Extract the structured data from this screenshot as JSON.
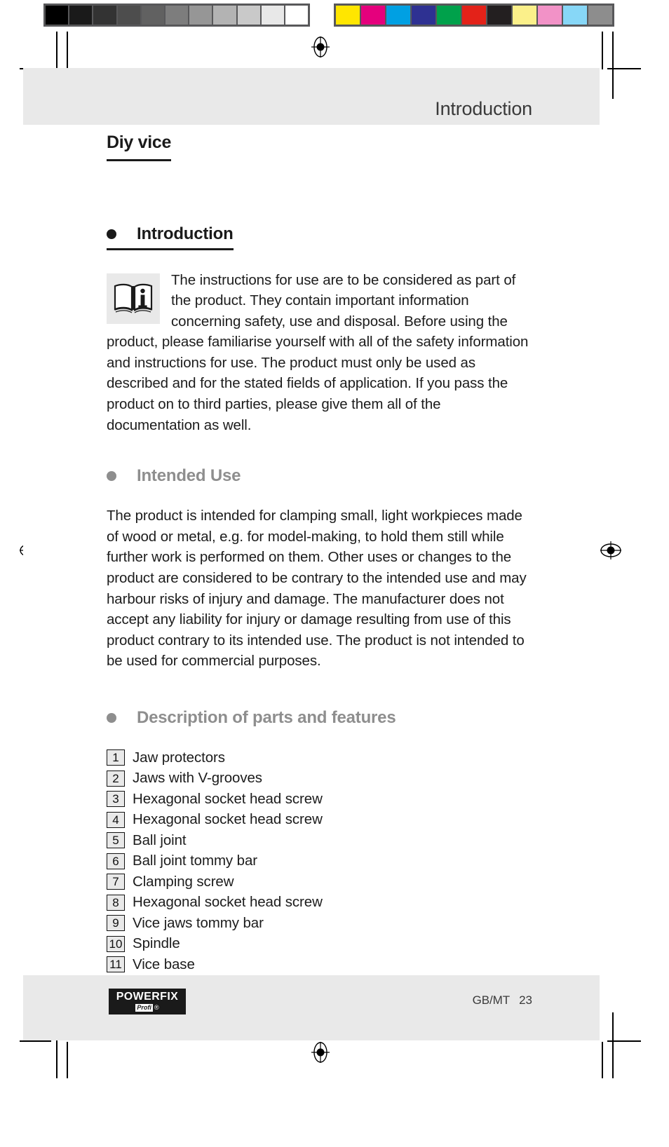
{
  "calibration": {
    "grayscale_swatches": [
      "#000000",
      "#1a1a1a",
      "#333333",
      "#4d4d4d",
      "#616161",
      "#7d7d7d",
      "#969696",
      "#b3b3b3",
      "#c9c9c9",
      "#e8e8e8",
      "#ffffff"
    ],
    "color_swatches": [
      "#ffe600",
      "#e5007d",
      "#00a0e3",
      "#2e3192",
      "#00a14b",
      "#e32219",
      "#231f20",
      "#fbf08a",
      "#f292c7",
      "#87d7f7",
      "#8d8d8d"
    ],
    "strip_frame_color": "#58585a"
  },
  "header": {
    "running_title": "Introduction",
    "band_color": "#e9e9e9"
  },
  "document": {
    "product_title": "Diy vice"
  },
  "sections": [
    {
      "id": "introduction",
      "heading": "Introduction",
      "style": "dark",
      "bullet_color": "#1a1a1a",
      "note_icon": "open-book-info-icon",
      "paragraph": "The instructions for use are to be considered as part of the product. They contain important information concerning safety, use and disposal. Before using the product, please familiarise yourself with all of the safety information and instructions for use. The product must only be used as described and for the stated fields of application. If you pass the product on to third parties, please give them all of the documentation as well."
    },
    {
      "id": "intended-use",
      "heading": "Intended Use",
      "style": "gray",
      "bullet_color": "#8e8e8e",
      "paragraph": "The product is intended for clamping small, light workpieces made of wood or metal, e.g. for model-making, to hold them still while further work is performed on them. Other uses or changes to the product are considered to be contrary to the intended use and may harbour risks of injury and damage. The manufacturer does not accept any liability for injury or damage resulting from use of this product contrary to its intended use. The product is not intended to be used for commercial purposes."
    },
    {
      "id": "description-of-parts",
      "heading": "Description of parts and features",
      "style": "gray",
      "bullet_color": "#8e8e8e"
    }
  ],
  "parts_list": [
    {
      "number": "1",
      "label": "Jaw protectors"
    },
    {
      "number": "2",
      "label": "Jaws with V-grooves"
    },
    {
      "number": "3",
      "label": "Hexagonal socket head screw"
    },
    {
      "number": "4",
      "label": "Hexagonal socket head screw"
    },
    {
      "number": "5",
      "label": "Ball joint"
    },
    {
      "number": "6",
      "label": "Ball joint tommy bar"
    },
    {
      "number": "7",
      "label": "Clamping screw"
    },
    {
      "number": "8",
      "label": "Hexagonal socket head screw"
    },
    {
      "number": "9",
      "label": "Vice jaws tommy bar"
    },
    {
      "number": "10",
      "label": "Spindle"
    },
    {
      "number": "11",
      "label": "Vice base"
    }
  ],
  "footer": {
    "brand_name": "POWERFIX",
    "brand_sub": "Profi",
    "brand_reg": "®",
    "locale": "GB/MT",
    "page_number": "23",
    "band_color": "#e9e9e9"
  }
}
